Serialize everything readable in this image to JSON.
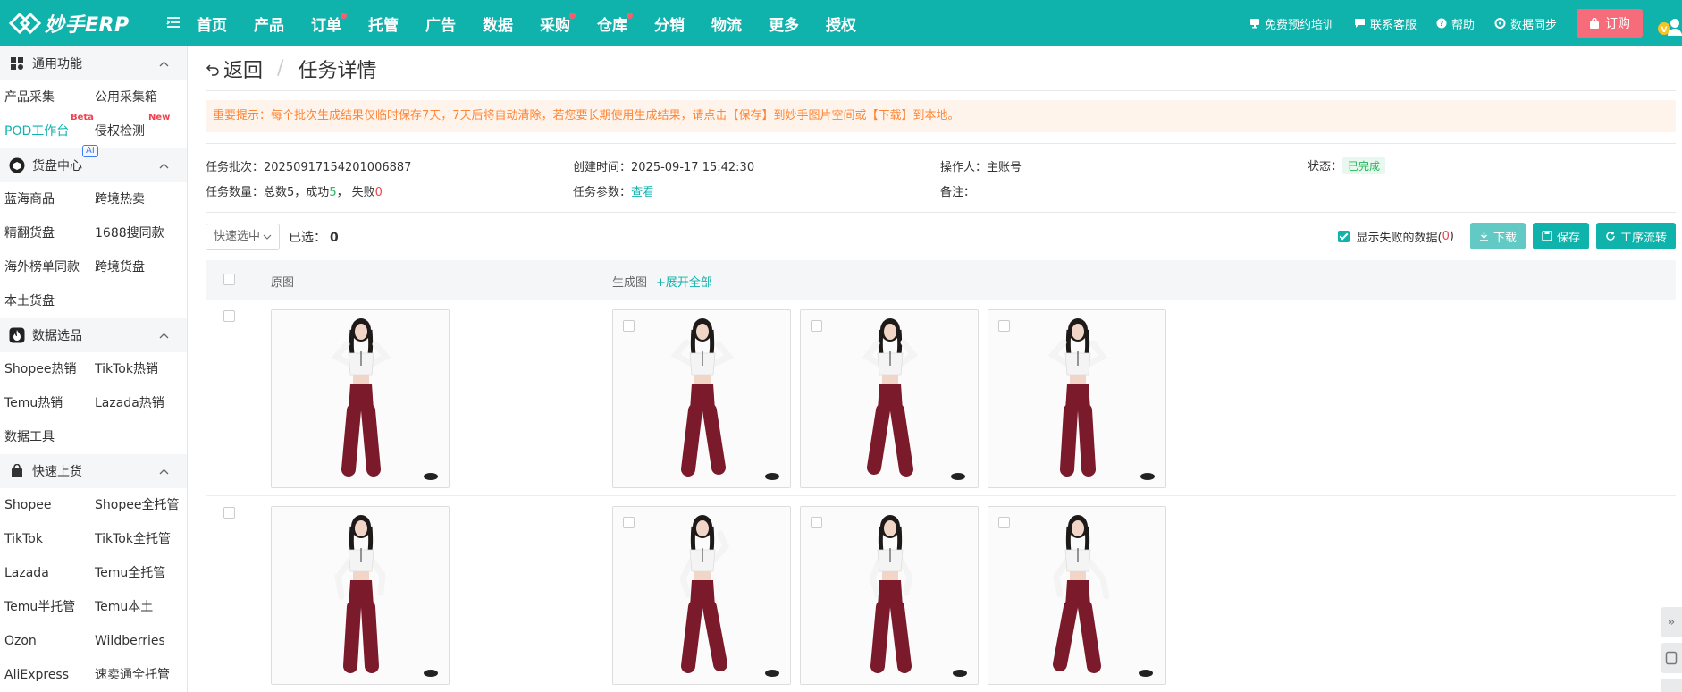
{
  "app": {
    "logo_text": "妙手ERP"
  },
  "nav": {
    "items": [
      {
        "label": "首页",
        "dot": false
      },
      {
        "label": "产品",
        "dot": false
      },
      {
        "label": "订单",
        "dot": true
      },
      {
        "label": "托管",
        "dot": false
      },
      {
        "label": "广告",
        "dot": false
      },
      {
        "label": "数据",
        "dot": false
      },
      {
        "label": "采购",
        "dot": true
      },
      {
        "label": "仓库",
        "dot": true
      },
      {
        "label": "分销",
        "dot": false
      },
      {
        "label": "物流",
        "dot": false
      },
      {
        "label": "更多",
        "dot": false
      },
      {
        "label": "授权",
        "dot": false
      }
    ]
  },
  "top_right": {
    "training": "免费预约培训",
    "support": "联系客服",
    "help": "帮助",
    "sync": "数据同步",
    "order": "订购"
  },
  "sidebar": {
    "groups": [
      {
        "title": "通用功能",
        "icon": "grid-icon",
        "items": [
          {
            "label": "产品采集"
          },
          {
            "label": "公用采集箱"
          },
          {
            "label": "POD工作台",
            "badge": "Beta",
            "active": true
          },
          {
            "label": "侵权检测",
            "badge": "New"
          }
        ]
      },
      {
        "title": "货盘中心",
        "icon": "box-icon",
        "tag": "AI",
        "items": [
          {
            "label": "蓝海商品"
          },
          {
            "label": "跨境热卖"
          },
          {
            "label": "精翻货盘"
          },
          {
            "label": "1688搜同款"
          },
          {
            "label": "海外榜单同款"
          },
          {
            "label": "跨境货盘"
          },
          {
            "label": "本土货盘"
          }
        ]
      },
      {
        "title": "数据选品",
        "icon": "fire-icon",
        "items": [
          {
            "label": "Shopee热销"
          },
          {
            "label": "TikTok热销"
          },
          {
            "label": "Temu热销"
          },
          {
            "label": "Lazada热销"
          },
          {
            "label": "数据工具"
          }
        ]
      },
      {
        "title": "快速上货",
        "icon": "bag-icon",
        "items": [
          {
            "label": "Shopee"
          },
          {
            "label": "Shopee全托管"
          },
          {
            "label": "TikTok"
          },
          {
            "label": "TikTok全托管"
          },
          {
            "label": "Lazada"
          },
          {
            "label": "Temu全托管"
          },
          {
            "label": "Temu半托管"
          },
          {
            "label": "Temu本土"
          },
          {
            "label": "Ozon"
          },
          {
            "label": "Wildberries"
          },
          {
            "label": "AliExpress"
          },
          {
            "label": "速卖通全托管"
          }
        ]
      }
    ]
  },
  "page": {
    "back": "返回",
    "separator": "/",
    "title": "任务详情",
    "notice": "重要提示：每个批次生成结果仅临时保存7天，7天后将自动清除，若您要长期使用生成结果，请点击【保存】到妙手图片空间或【下载】到本地。"
  },
  "task_info": {
    "batch_label": "任务批次：",
    "batch_value": "20250917154201006887",
    "created_label": "创建时间：",
    "created_value": "2025-09-17 15:42:30",
    "operator_label": "操作人：",
    "operator_value": "主账号",
    "status_label": "状态：",
    "status_value": "已完成",
    "count_label": "任务数量：",
    "total_text": "总数5，",
    "success_text": "成功",
    "success_value": "5",
    "success_suffix": "，",
    "fail_text": "失败",
    "fail_value": "0",
    "params_label": "任务参数：",
    "params_link": "查看",
    "remark_label": "备注：",
    "remark_value": ""
  },
  "toolbar": {
    "quick_select": "快速选中",
    "selected_label": "已选：",
    "selected_count": "0",
    "show_failed": "显示失败的数据(",
    "failed_count": "0",
    "show_failed_close": ")",
    "show_failed_checked": true,
    "download": "下载",
    "save": "保存",
    "workflow": "工序流转"
  },
  "table": {
    "col_original": "原图",
    "col_generated": "生成图",
    "expand_all": "+展开全部"
  },
  "colors": {
    "primary": "#0fb3ac",
    "warning_text": "#ff8636",
    "warning_bg": "#fff4ec",
    "success": "#23b85a",
    "danger": "#f0424f",
    "order_button": "#f76c7b",
    "pants": "#7a1a2a"
  }
}
